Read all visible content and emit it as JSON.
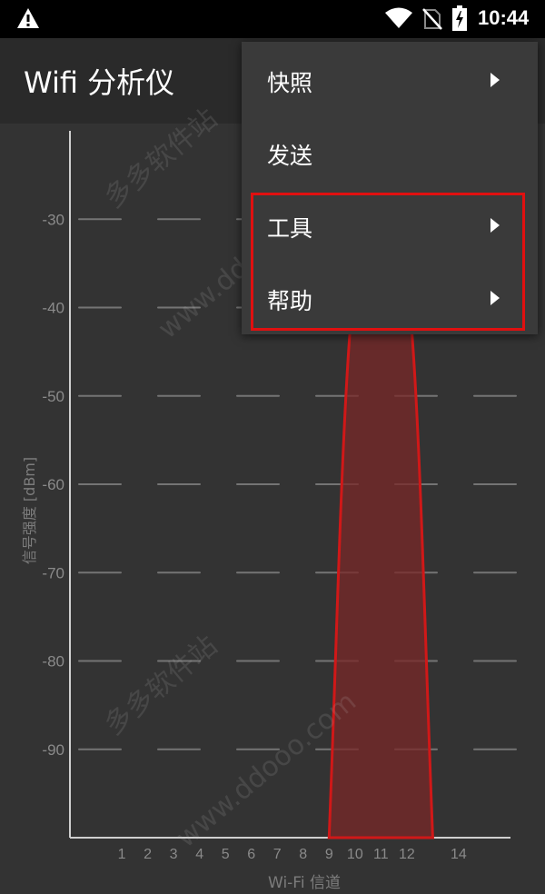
{
  "status_bar": {
    "time": "10:44",
    "icons": [
      "warning-icon",
      "wifi-icon",
      "no-sim-icon",
      "battery-charging-icon"
    ]
  },
  "app_bar": {
    "title": "Wifi 分析仪"
  },
  "menu": {
    "items": [
      {
        "label": "快照",
        "has_submenu": true
      },
      {
        "label": "发送",
        "has_submenu": false
      },
      {
        "label": "工具",
        "has_submenu": true
      },
      {
        "label": "帮助",
        "has_submenu": true
      }
    ],
    "highlight_color": "#e01010"
  },
  "watermarks": [
    "多多软件站",
    "www.ddooo.com",
    "多多软件站",
    "www.ddooo.com"
  ],
  "chart_data": {
    "type": "area",
    "ylabel": "信号强度 [dBm]",
    "xlabel": "Wi-Fi 信道",
    "y_ticks": [
      "-30",
      "-40",
      "-50",
      "-60",
      "-70",
      "-80",
      "-90"
    ],
    "y_values": [
      -30,
      -40,
      -50,
      -60,
      -70,
      -80,
      -90
    ],
    "ylim": [
      -100,
      -20
    ],
    "x_ticks": [
      "1",
      "2",
      "3",
      "4",
      "5",
      "6",
      "7",
      "8",
      "9",
      "10",
      "11",
      "12",
      "14"
    ],
    "x_values": [
      1,
      2,
      3,
      4,
      5,
      6,
      7,
      8,
      9,
      10,
      11,
      12,
      14
    ],
    "xlim": [
      -1,
      16
    ],
    "series": [
      {
        "channel": 11,
        "x_range": [
          9,
          13
        ],
        "peak_dbm": -30,
        "color": "#d01818",
        "fill": "#7a2828"
      }
    ],
    "grid": true
  }
}
